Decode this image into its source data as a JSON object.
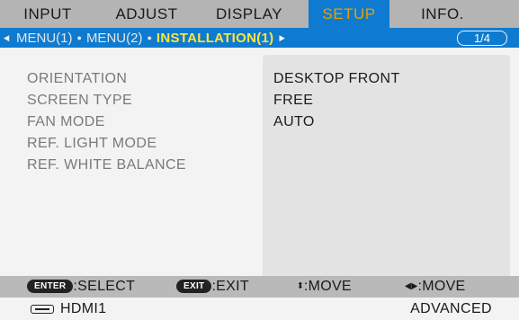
{
  "tabs": [
    {
      "label": "INPUT",
      "active": false
    },
    {
      "label": "ADJUST",
      "active": false
    },
    {
      "label": "DISPLAY",
      "active": false
    },
    {
      "label": "SETUP",
      "active": true
    },
    {
      "label": "INFO.",
      "active": false
    }
  ],
  "submenu": {
    "left_arrow": "◀",
    "items": [
      "MENU(1)",
      "MENU(2)",
      "INSTALLATION(1)"
    ],
    "separator": "●",
    "right_arrow": "▶",
    "page": "1/4"
  },
  "settings": [
    {
      "label": "ORIENTATION",
      "value": "DESKTOP FRONT"
    },
    {
      "label": "SCREEN TYPE",
      "value": "FREE"
    },
    {
      "label": "FAN MODE",
      "value": "AUTO"
    },
    {
      "label": "REF. LIGHT MODE",
      "value": ""
    },
    {
      "label": "REF. WHITE BALANCE",
      "value": ""
    }
  ],
  "help": {
    "enter_key": "ENTER",
    "enter_text": ":SELECT",
    "exit_key": "EXIT",
    "exit_text": ":EXIT",
    "updown_symbol": "⬍",
    "updown_text": ":MOVE",
    "leftright_symbol": "◀▶",
    "leftright_text": ":MOVE"
  },
  "status": {
    "source_icon": "hdmi-port-icon",
    "source": "HDMI1",
    "mode": "ADVANCED"
  },
  "colors": {
    "tab_bar": "#b4b4b4",
    "accent_blue": "#0f7bd0",
    "active_tab_text": "#e9a000",
    "current_crumb": "#ffe63c"
  }
}
